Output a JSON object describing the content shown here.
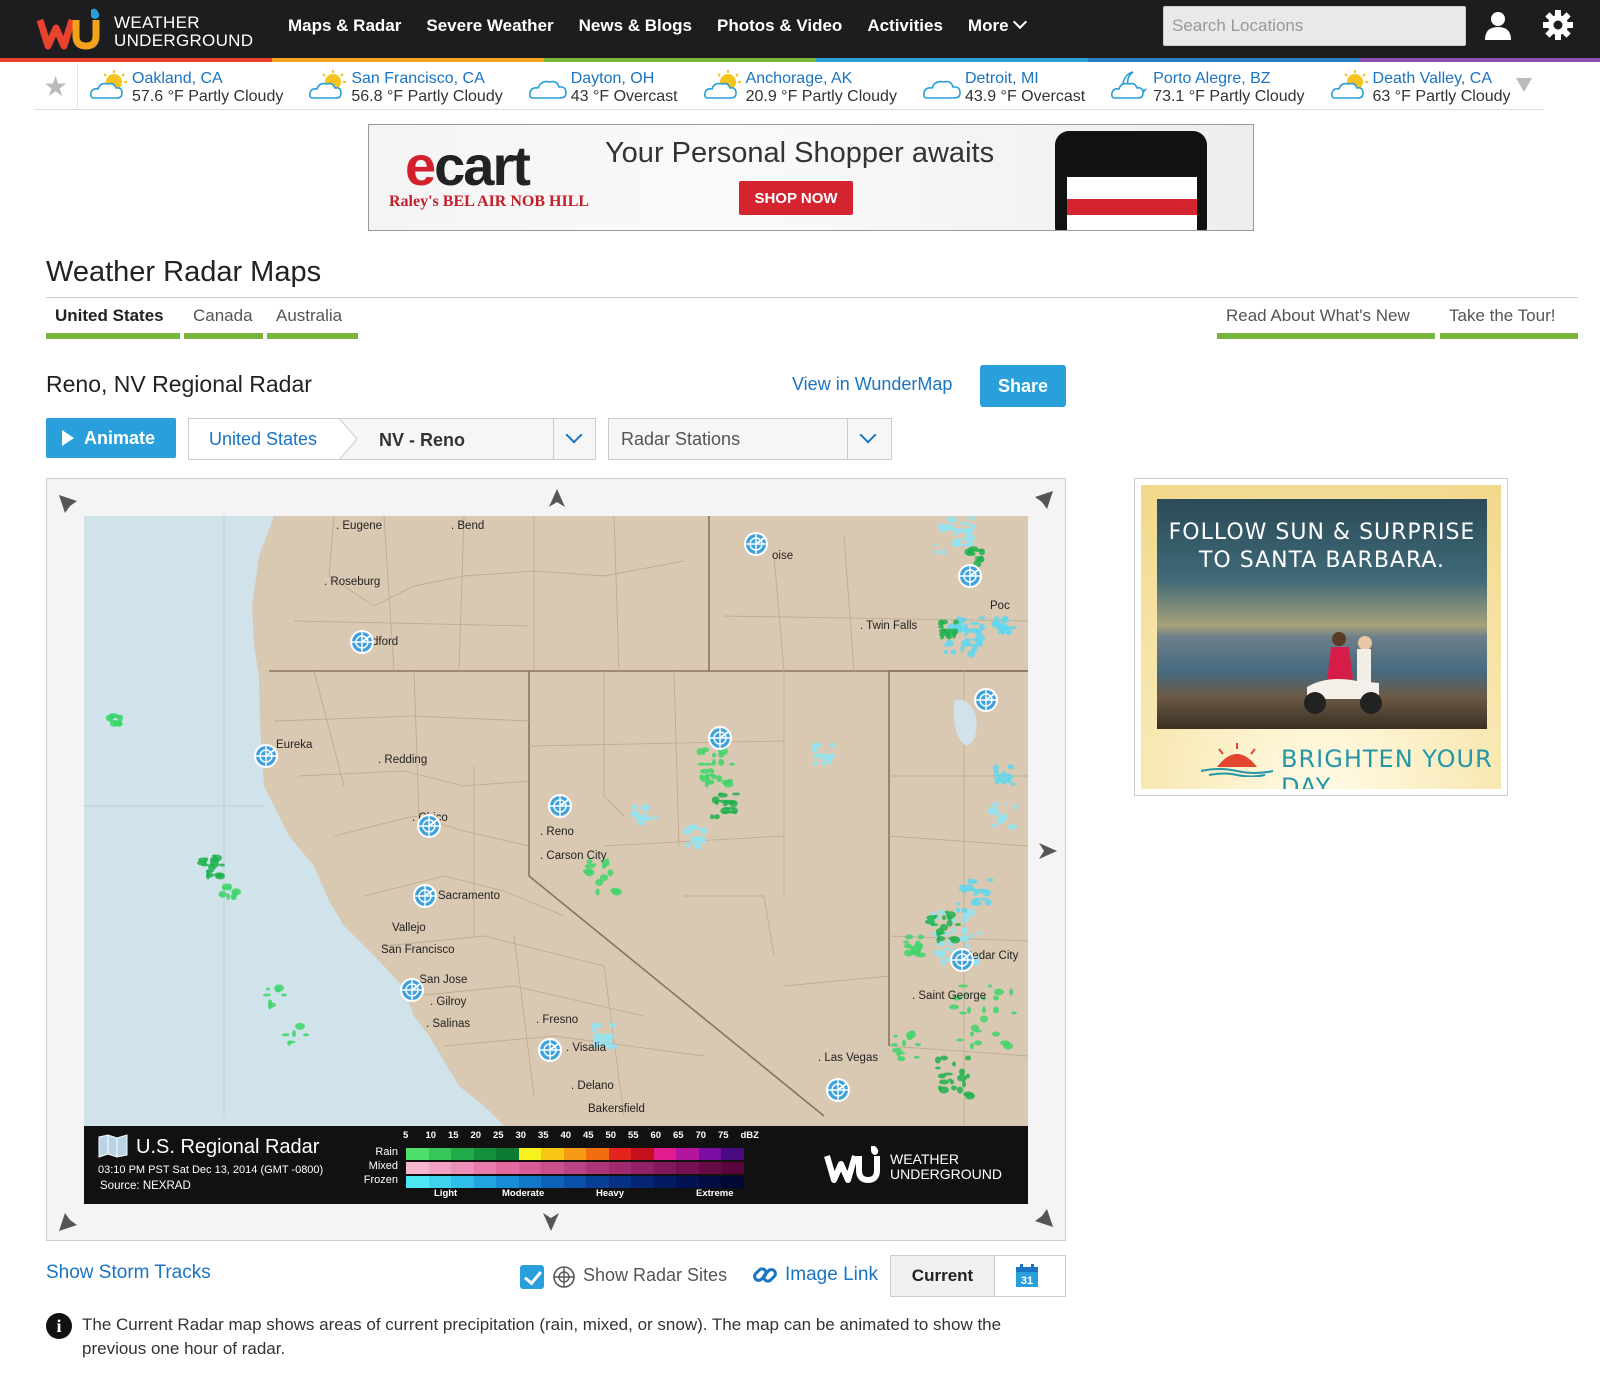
{
  "brand": {
    "line1": "WEATHER",
    "line2": "UNDERGROUND"
  },
  "nav": {
    "items": [
      "Maps & Radar",
      "Severe Weather",
      "News & Blogs",
      "Photos & Video",
      "Activities",
      "More"
    ],
    "search_placeholder": "Search Locations"
  },
  "favorites": [
    {
      "city": "Oakland, CA",
      "cond": "57.6 °F Partly Cloudy",
      "icon": "partly-cloudy"
    },
    {
      "city": "San Francisco, CA",
      "cond": "56.8 °F Partly Cloudy",
      "icon": "partly-cloudy"
    },
    {
      "city": "Dayton, OH",
      "cond": "43 °F Overcast",
      "icon": "cloudy"
    },
    {
      "city": "Anchorage, AK",
      "cond": "20.9 °F Partly Cloudy",
      "icon": "partly-cloudy"
    },
    {
      "city": "Detroit, MI",
      "cond": "43.9 °F Overcast",
      "icon": "cloudy"
    },
    {
      "city": "Porto Alegre, BZ",
      "cond": "73.1 °F Partly Cloudy",
      "icon": "partly-cloudy-night"
    },
    {
      "city": "Death Valley, CA",
      "cond": "63 °F Partly Cloudy",
      "icon": "partly-cloudy"
    }
  ],
  "top_ad": {
    "brand_e": "e",
    "brand_rest": "cart",
    "stores": "Raley's   BEL AIR   NOB HILL",
    "tagline": "Your Personal Shopper awaits",
    "cta": "SHOP NOW"
  },
  "page": {
    "title": "Weather Radar Maps",
    "tabs": [
      "United States",
      "Canada",
      "Australia"
    ],
    "right_tabs": [
      "Read About What's New",
      "Take the Tour!"
    ]
  },
  "radar": {
    "title": "Reno, NV Regional Radar",
    "wundermap_link": "View in WunderMap",
    "share": "Share",
    "animate": "Animate",
    "crumb_root": "United States",
    "crumb_selected": "NV - Reno",
    "stations_select": "Radar Stations"
  },
  "map": {
    "cities": [
      {
        "name": ". Eugene"
      },
      {
        "name": ". Bend"
      },
      {
        "name": ". Roseburg"
      },
      {
        "name": "Medford"
      },
      {
        "name": "Eureka"
      },
      {
        "name": ". Redding"
      },
      {
        "name": ". Chico"
      },
      {
        "name": ". Reno"
      },
      {
        "name": ". Carson City"
      },
      {
        "name": "Sacramento"
      },
      {
        "name": "Vallejo"
      },
      {
        "name": "San Francisco"
      },
      {
        "name": ". San Jose"
      },
      {
        "name": ". Gilroy"
      },
      {
        "name": ". Salinas"
      },
      {
        "name": ". Fresno"
      },
      {
        "name": ". Visalia"
      },
      {
        "name": ". Delano"
      },
      {
        "name": "Bakersfield"
      },
      {
        "name": "oise"
      },
      {
        "name": ". Twin Falls"
      },
      {
        "name": "Poc"
      },
      {
        "name": "Cedar City"
      },
      {
        "name": ". Saint George"
      },
      {
        "name": ". Las Vegas"
      }
    ]
  },
  "legend": {
    "title": "U.S. Regional Radar",
    "time": "03:10 PM PST Sat Dec 13, 2014 (GMT -0800)",
    "source": "Source: NEXRAD",
    "dbz_values": [
      "5",
      "10",
      "15",
      "20",
      "25",
      "30",
      "35",
      "40",
      "45",
      "50",
      "55",
      "60",
      "65",
      "70",
      "75",
      "dBZ"
    ],
    "rows": [
      "Rain",
      "Mixed",
      "Frozen"
    ],
    "intensity": [
      "Light",
      "Moderate",
      "Heavy",
      "Extreme"
    ],
    "rain_colors": [
      "#4fe06b",
      "#37c659",
      "#22a94a",
      "#14903d",
      "#0c7a33",
      "#f7f11d",
      "#f9c616",
      "#f79a14",
      "#f26d10",
      "#e3231d",
      "#c3101a",
      "#e21b8f",
      "#b4159f",
      "#7a0ea4",
      "#4a0a82"
    ],
    "mixed_colors": [
      "#f7b5d0",
      "#f2a2c4",
      "#ee8fb8",
      "#e97cad",
      "#e469a1",
      "#d75b97",
      "#c94f8d",
      "#bb4283",
      "#ad3678",
      "#9f2a6e",
      "#912064",
      "#83185a",
      "#741050",
      "#660a46",
      "#58063c"
    ],
    "frozen_colors": [
      "#4ee8f2",
      "#3fd3f0",
      "#2fbdea",
      "#22a5e1",
      "#188dd6",
      "#1178c9",
      "#0c63b9",
      "#0950a8",
      "#073f96",
      "#063084",
      "#052473",
      "#041a62",
      "#031252",
      "#020c43",
      "#020836"
    ]
  },
  "controls": {
    "storm_tracks": "Show Storm Tracks",
    "radar_sites": "Show Radar Sites",
    "image_link": "Image Link",
    "current": "Current",
    "calendar_day": "31"
  },
  "info": "The Current Radar map shows areas of current precipitation (rain, mixed, or snow). The map can be animated to show the previous one hour of radar.",
  "side_ad": {
    "headline_1": "FOLLOW SUN & SURPRISE",
    "headline_2": "TO SANTA BARBARA.",
    "footer": "BRIGHTEN YOUR DAY"
  },
  "colors": {
    "link": "#1a74c2",
    "accent": "#29a0dc",
    "tab_underline": "#77b63b",
    "nav_bg": "#1d1d1f"
  }
}
